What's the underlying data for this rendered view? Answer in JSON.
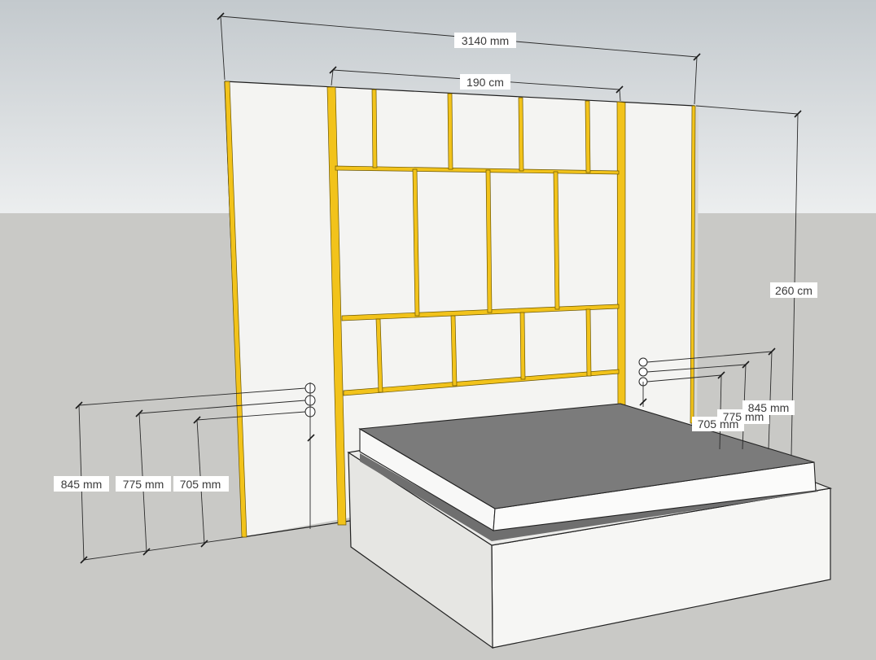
{
  "colors": {
    "sky": "#d6dbde",
    "ground": "#c9c9c6",
    "wall": "#f4f4f2",
    "batten": "#f2c31b",
    "mattress_top": "#7a7a7a",
    "bed_base": "#eeeeec"
  },
  "dimensions": {
    "overall_width": "3140 mm",
    "inner_width": "190 cm",
    "height": "260 cm",
    "left_845": "845 mm",
    "left_775": "775 mm",
    "left_705": "705 mm",
    "right_845": "845 mm",
    "right_775": "775 mm",
    "right_705": "705 mm"
  }
}
